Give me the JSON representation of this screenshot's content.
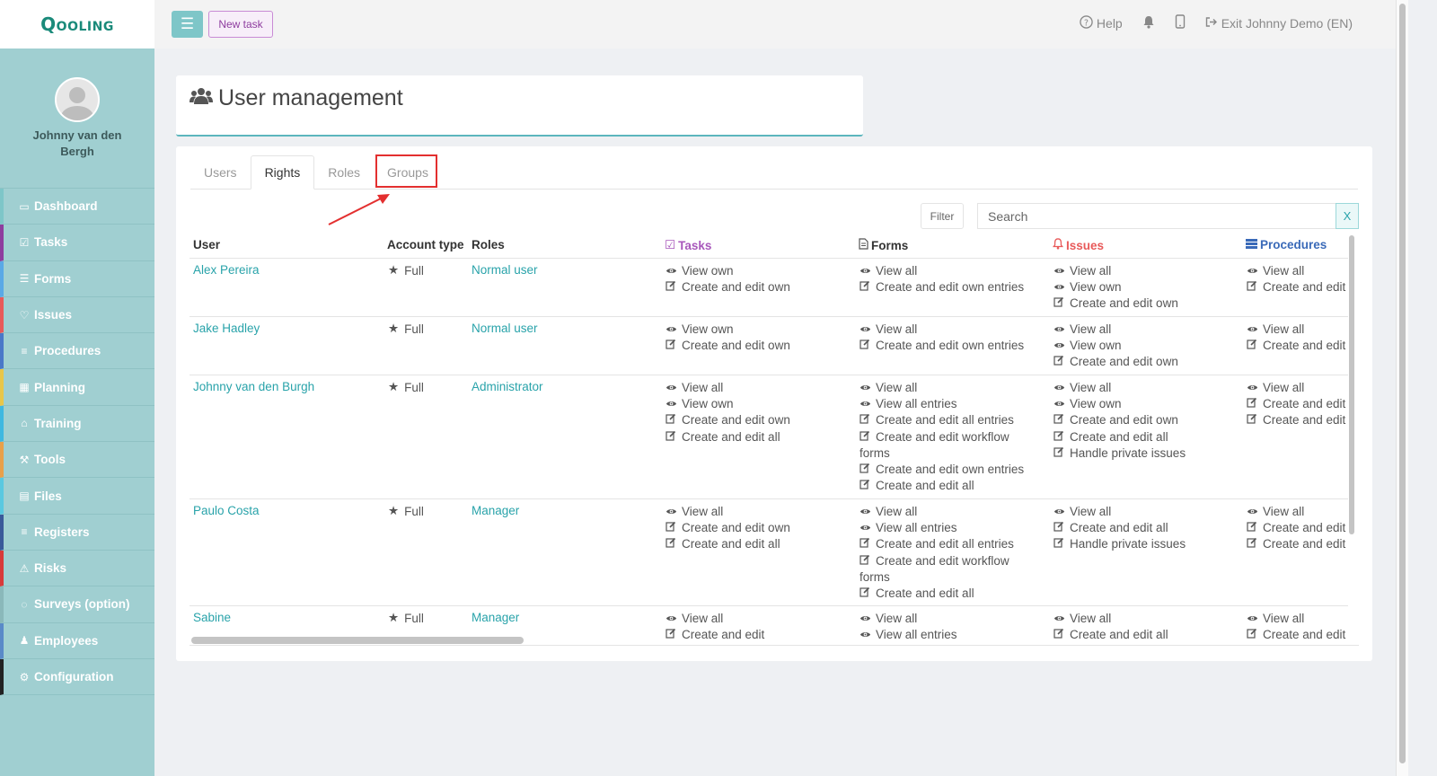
{
  "brand": {
    "logo": "Qooling"
  },
  "profile": {
    "name": "Johnny van den Bergh"
  },
  "sidebar": {
    "items": [
      {
        "label": "Dashboard",
        "icon": "monitor-icon",
        "color": "#7ec6c8"
      },
      {
        "label": "Tasks",
        "icon": "check-square-icon",
        "color": "#8e3d9f"
      },
      {
        "label": "Forms",
        "icon": "file-icon",
        "color": "#5aa9e6"
      },
      {
        "label": "Issues",
        "icon": "bell-icon",
        "color": "#e85a5a"
      },
      {
        "label": "Procedures",
        "icon": "list-icon",
        "color": "#4a78c8"
      },
      {
        "label": "Planning",
        "icon": "calendar-icon",
        "color": "#e8c64a"
      },
      {
        "label": "Training",
        "icon": "graduation-cap-icon",
        "color": "#3fb8e0"
      },
      {
        "label": "Tools",
        "icon": "wrench-icon",
        "color": "#e8a04a"
      },
      {
        "label": "Files",
        "icon": "document-icon",
        "color": "#5ac8e0"
      },
      {
        "label": "Registers",
        "icon": "bars-icon",
        "color": "#3a5a9a"
      },
      {
        "label": "Risks",
        "icon": "warning-icon",
        "color": "#d83a3a"
      },
      {
        "label": "Surveys (option)",
        "icon": "chat-icon",
        "color": "#8ab8ba"
      },
      {
        "label": "Employees",
        "icon": "users-icon",
        "color": "#5a8ac8"
      },
      {
        "label": "Configuration",
        "icon": "gear-icon",
        "color": "#222222"
      }
    ]
  },
  "topbar": {
    "new_task": "New task",
    "help": "Help",
    "exit": "Exit Johnny Demo (EN)"
  },
  "page": {
    "title": "User management"
  },
  "tabs": [
    "Users",
    "Rights",
    "Roles",
    "Groups"
  ],
  "toolbar": {
    "filter": "Filter",
    "search_placeholder": "Search",
    "clear": "X"
  },
  "table": {
    "headers": {
      "user": "User",
      "account_type": "Account type",
      "roles": "Roles",
      "tasks": "Tasks",
      "forms": "Forms",
      "issues": "Issues",
      "procedures": "Procedures"
    },
    "header_colors": {
      "tasks": "#a857bb",
      "issues": "#e85a5a",
      "procedures": "#3a6ab8"
    },
    "rows": [
      {
        "user": "Alex Pereira",
        "account_type": "Full",
        "role": "Normal user",
        "tasks": [
          {
            "icon": "eye",
            "text": "View own"
          },
          {
            "icon": "edit",
            "text": "Create and edit own"
          }
        ],
        "forms": [
          {
            "icon": "eye",
            "text": "View all"
          },
          {
            "icon": "edit",
            "text": "Create and edit own entries"
          }
        ],
        "issues": [
          {
            "icon": "eye",
            "text": "View all"
          },
          {
            "icon": "eye",
            "text": "View own"
          },
          {
            "icon": "edit",
            "text": "Create and edit own"
          }
        ],
        "procedures": [
          {
            "icon": "eye",
            "text": "View all"
          },
          {
            "icon": "edit",
            "text": "Create and edit"
          }
        ]
      },
      {
        "user": "Jake Hadley",
        "account_type": "Full",
        "role": "Normal user",
        "tasks": [
          {
            "icon": "eye",
            "text": "View own"
          },
          {
            "icon": "edit",
            "text": "Create and edit own"
          }
        ],
        "forms": [
          {
            "icon": "eye",
            "text": "View all"
          },
          {
            "icon": "edit",
            "text": "Create and edit own entries"
          }
        ],
        "issues": [
          {
            "icon": "eye",
            "text": "View all"
          },
          {
            "icon": "eye",
            "text": "View own"
          },
          {
            "icon": "edit",
            "text": "Create and edit own"
          }
        ],
        "procedures": [
          {
            "icon": "eye",
            "text": "View all"
          },
          {
            "icon": "edit",
            "text": "Create and edit"
          }
        ]
      },
      {
        "user": "Johnny van den Burgh",
        "account_type": "Full",
        "role": "Administrator",
        "tasks": [
          {
            "icon": "eye",
            "text": "View all"
          },
          {
            "icon": "eye",
            "text": "View own"
          },
          {
            "icon": "edit",
            "text": "Create and edit own"
          },
          {
            "icon": "edit",
            "text": "Create and edit all"
          }
        ],
        "forms": [
          {
            "icon": "eye",
            "text": "View all"
          },
          {
            "icon": "eye",
            "text": "View all entries"
          },
          {
            "icon": "edit",
            "text": "Create and edit all entries"
          },
          {
            "icon": "edit",
            "text": "Create and edit workflow forms"
          },
          {
            "icon": "edit",
            "text": "Create and edit own entries"
          },
          {
            "icon": "edit",
            "text": "Create and edit all"
          }
        ],
        "issues": [
          {
            "icon": "eye",
            "text": "View all"
          },
          {
            "icon": "eye",
            "text": "View own"
          },
          {
            "icon": "edit",
            "text": "Create and edit own"
          },
          {
            "icon": "edit",
            "text": "Create and edit all"
          },
          {
            "icon": "edit",
            "text": "Handle private issues"
          }
        ],
        "procedures": [
          {
            "icon": "eye",
            "text": "View all"
          },
          {
            "icon": "edit",
            "text": "Create and edit"
          },
          {
            "icon": "edit",
            "text": "Create and edit"
          }
        ]
      },
      {
        "user": "Paulo Costa",
        "account_type": "Full",
        "role": "Manager",
        "tasks": [
          {
            "icon": "eye",
            "text": "View all"
          },
          {
            "icon": "edit",
            "text": "Create and edit own"
          },
          {
            "icon": "edit",
            "text": "Create and edit all"
          }
        ],
        "forms": [
          {
            "icon": "eye",
            "text": "View all"
          },
          {
            "icon": "eye",
            "text": "View all entries"
          },
          {
            "icon": "edit",
            "text": "Create and edit all entries"
          },
          {
            "icon": "edit",
            "text": "Create and edit workflow forms"
          },
          {
            "icon": "edit",
            "text": "Create and edit all"
          }
        ],
        "issues": [
          {
            "icon": "eye",
            "text": "View all"
          },
          {
            "icon": "edit",
            "text": "Create and edit all"
          },
          {
            "icon": "edit",
            "text": "Handle private issues"
          }
        ],
        "procedures": [
          {
            "icon": "eye",
            "text": "View all"
          },
          {
            "icon": "edit",
            "text": "Create and edit"
          },
          {
            "icon": "edit",
            "text": "Create and edit"
          }
        ]
      },
      {
        "user": "Sabine",
        "account_type": "Full",
        "role": "Manager",
        "tasks": [
          {
            "icon": "eye",
            "text": "View all"
          },
          {
            "icon": "edit",
            "text": "Create and edit"
          }
        ],
        "forms": [
          {
            "icon": "eye",
            "text": "View all"
          },
          {
            "icon": "eye",
            "text": "View all entries"
          }
        ],
        "issues": [
          {
            "icon": "eye",
            "text": "View all"
          },
          {
            "icon": "edit",
            "text": "Create and edit all"
          }
        ],
        "procedures": [
          {
            "icon": "eye",
            "text": "View all"
          },
          {
            "icon": "edit",
            "text": "Create and edit"
          }
        ]
      }
    ]
  }
}
